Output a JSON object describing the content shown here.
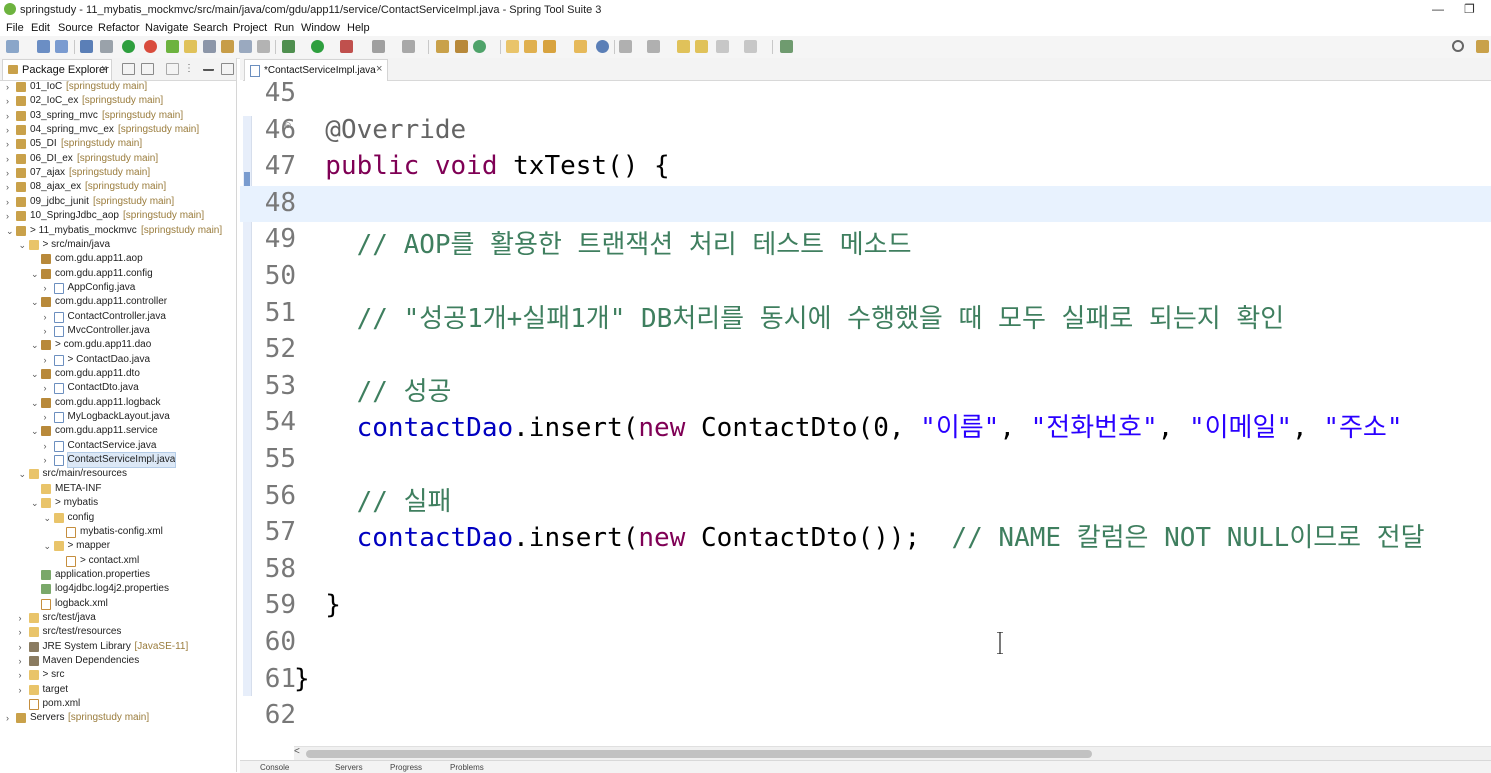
{
  "window": {
    "title": "springstudy - 11_mybatis_mockmvc/src/main/java/com/gdu/app11/service/ContactServiceImpl.java - Spring Tool Suite 3",
    "minimize": "—",
    "maximize": "❐"
  },
  "menu": [
    "File",
    "Edit",
    "Source",
    "Refactor",
    "Navigate",
    "Search",
    "Project",
    "Run",
    "Window",
    "Help"
  ],
  "explorer": {
    "tab_label": "Package Explorer",
    "tree": [
      {
        "label": "01_IoC",
        "deco": "[springstudy main]",
        "indent": 0,
        "arrow": ">",
        "icon": "project"
      },
      {
        "label": "02_IoC_ex",
        "deco": "[springstudy main]",
        "indent": 0,
        "arrow": ">",
        "icon": "project"
      },
      {
        "label": "03_spring_mvc",
        "deco": "[springstudy main]",
        "indent": 0,
        "arrow": ">",
        "icon": "project"
      },
      {
        "label": "04_spring_mvc_ex",
        "deco": "[springstudy main]",
        "indent": 0,
        "arrow": ">",
        "icon": "project"
      },
      {
        "label": "05_DI",
        "deco": "[springstudy main]",
        "indent": 0,
        "arrow": ">",
        "icon": "project"
      },
      {
        "label": "06_DI_ex",
        "deco": "[springstudy main]",
        "indent": 0,
        "arrow": ">",
        "icon": "project"
      },
      {
        "label": "07_ajax",
        "deco": "[springstudy main]",
        "indent": 0,
        "arrow": ">",
        "icon": "project"
      },
      {
        "label": "08_ajax_ex",
        "deco": "[springstudy main]",
        "indent": 0,
        "arrow": ">",
        "icon": "project"
      },
      {
        "label": "09_jdbc_junit",
        "deco": "[springstudy main]",
        "indent": 0,
        "arrow": ">",
        "icon": "project"
      },
      {
        "label": "10_SpringJdbc_aop",
        "deco": "[springstudy main]",
        "indent": 0,
        "arrow": ">",
        "icon": "project"
      },
      {
        "label": "> 11_mybatis_mockmvc",
        "deco": "[springstudy main]",
        "indent": 0,
        "arrow": "v",
        "icon": "project"
      },
      {
        "label": "> src/main/java",
        "deco": "",
        "indent": 1,
        "arrow": "v",
        "icon": "folder"
      },
      {
        "label": "com.gdu.app11.aop",
        "deco": "",
        "indent": 2,
        "arrow": "",
        "icon": "package"
      },
      {
        "label": "com.gdu.app11.config",
        "deco": "",
        "indent": 2,
        "arrow": "v",
        "icon": "package"
      },
      {
        "label": "AppConfig.java",
        "deco": "",
        "indent": 3,
        "arrow": ">",
        "icon": "java"
      },
      {
        "label": "com.gdu.app11.controller",
        "deco": "",
        "indent": 2,
        "arrow": "v",
        "icon": "package"
      },
      {
        "label": "ContactController.java",
        "deco": "",
        "indent": 3,
        "arrow": ">",
        "icon": "java"
      },
      {
        "label": "MvcController.java",
        "deco": "",
        "indent": 3,
        "arrow": ">",
        "icon": "java"
      },
      {
        "label": "> com.gdu.app11.dao",
        "deco": "",
        "indent": 2,
        "arrow": "v",
        "icon": "package"
      },
      {
        "label": "> ContactDao.java",
        "deco": "",
        "indent": 3,
        "arrow": ">",
        "icon": "java"
      },
      {
        "label": "com.gdu.app11.dto",
        "deco": "",
        "indent": 2,
        "arrow": "v",
        "icon": "package"
      },
      {
        "label": "ContactDto.java",
        "deco": "",
        "indent": 3,
        "arrow": ">",
        "icon": "java"
      },
      {
        "label": "com.gdu.app11.logback",
        "deco": "",
        "indent": 2,
        "arrow": "v",
        "icon": "package"
      },
      {
        "label": "MyLogbackLayout.java",
        "deco": "",
        "indent": 3,
        "arrow": ">",
        "icon": "java"
      },
      {
        "label": "com.gdu.app11.service",
        "deco": "",
        "indent": 2,
        "arrow": "v",
        "icon": "package"
      },
      {
        "label": "ContactService.java",
        "deco": "",
        "indent": 3,
        "arrow": ">",
        "icon": "java"
      },
      {
        "label": "ContactServiceImpl.java",
        "deco": "",
        "indent": 3,
        "arrow": ">",
        "icon": "java",
        "selected": true
      },
      {
        "label": "src/main/resources",
        "deco": "",
        "indent": 1,
        "arrow": "v",
        "icon": "folder"
      },
      {
        "label": "META-INF",
        "deco": "",
        "indent": 2,
        "arrow": "",
        "icon": "folder"
      },
      {
        "label": "> mybatis",
        "deco": "",
        "indent": 2,
        "arrow": "v",
        "icon": "folder"
      },
      {
        "label": "config",
        "deco": "",
        "indent": 3,
        "arrow": "v",
        "icon": "folder"
      },
      {
        "label": "mybatis-config.xml",
        "deco": "",
        "indent": 4,
        "arrow": "",
        "icon": "xml"
      },
      {
        "label": "> mapper",
        "deco": "",
        "indent": 3,
        "arrow": "v",
        "icon": "folder"
      },
      {
        "label": "> contact.xml",
        "deco": "",
        "indent": 4,
        "arrow": "",
        "icon": "xml"
      },
      {
        "label": "application.properties",
        "deco": "",
        "indent": 2,
        "arrow": "",
        "icon": "props"
      },
      {
        "label": "log4jdbc.log4j2.properties",
        "deco": "",
        "indent": 2,
        "arrow": "",
        "icon": "props"
      },
      {
        "label": "logback.xml",
        "deco": "",
        "indent": 2,
        "arrow": "",
        "icon": "xml"
      },
      {
        "label": "src/test/java",
        "deco": "",
        "indent": 1,
        "arrow": ">",
        "icon": "folder"
      },
      {
        "label": "src/test/resources",
        "deco": "",
        "indent": 1,
        "arrow": ">",
        "icon": "folder"
      },
      {
        "label": "JRE System Library",
        "deco": "[JavaSE-11]",
        "indent": 1,
        "arrow": ">",
        "icon": "lib"
      },
      {
        "label": "Maven Dependencies",
        "deco": "",
        "indent": 1,
        "arrow": ">",
        "icon": "lib"
      },
      {
        "label": "> src",
        "deco": "",
        "indent": 1,
        "arrow": ">",
        "icon": "folder"
      },
      {
        "label": "target",
        "deco": "",
        "indent": 1,
        "arrow": ">",
        "icon": "folder"
      },
      {
        "label": "pom.xml",
        "deco": "",
        "indent": 1,
        "arrow": "",
        "icon": "xml"
      },
      {
        "label": "Servers",
        "deco": "[springstudy main]",
        "indent": 0,
        "arrow": ">",
        "icon": "project"
      }
    ]
  },
  "editor": {
    "tab_label": "*ContactServiceImpl.java",
    "current_line": "48",
    "lines": [
      {
        "num": "45",
        "tokens": []
      },
      {
        "num": "46",
        "fold": true,
        "tokens": [
          {
            "t": "  @Override",
            "c": "annot"
          }
        ]
      },
      {
        "num": "47",
        "tokens": [
          {
            "t": "  public void ",
            "c": "kw"
          },
          {
            "t": "txTest() {",
            "c": "plain"
          }
        ]
      },
      {
        "num": "48",
        "tokens": [
          {
            "t": "    ",
            "c": "plain"
          }
        ]
      },
      {
        "num": "49",
        "tokens": [
          {
            "t": "    // AOP를 활용한 트랜잭션 처리 테스트 메소드",
            "c": "cmt"
          }
        ]
      },
      {
        "num": "50",
        "tokens": []
      },
      {
        "num": "51",
        "tokens": [
          {
            "t": "    // \"성공1개+실패1개\" DB처리를 동시에 수행했을 때 모두 실패로 되는지 확인",
            "c": "cmt"
          }
        ]
      },
      {
        "num": "52",
        "tokens": []
      },
      {
        "num": "53",
        "tokens": [
          {
            "t": "    // 성공",
            "c": "cmt"
          }
        ]
      },
      {
        "num": "54",
        "tokens": [
          {
            "t": "    contactDao",
            "c": "field"
          },
          {
            "t": ".insert(",
            "c": "plain"
          },
          {
            "t": "new ",
            "c": "kw"
          },
          {
            "t": "ContactDto(0, ",
            "c": "plain"
          },
          {
            "t": "\"이름\"",
            "c": "str"
          },
          {
            "t": ", ",
            "c": "plain"
          },
          {
            "t": "\"전화번호\"",
            "c": "str"
          },
          {
            "t": ", ",
            "c": "plain"
          },
          {
            "t": "\"이메일\"",
            "c": "str"
          },
          {
            "t": ", ",
            "c": "plain"
          },
          {
            "t": "\"주소\"",
            "c": "str"
          }
        ]
      },
      {
        "num": "55",
        "tokens": []
      },
      {
        "num": "56",
        "tokens": [
          {
            "t": "    // 실패",
            "c": "cmt"
          }
        ]
      },
      {
        "num": "57",
        "tokens": [
          {
            "t": "    contactDao",
            "c": "field"
          },
          {
            "t": ".insert(",
            "c": "plain"
          },
          {
            "t": "new ",
            "c": "kw"
          },
          {
            "t": "ContactDto());  ",
            "c": "plain"
          },
          {
            "t": "// NAME 칼럼은 NOT NULL이므로 전달",
            "c": "cmt"
          }
        ]
      },
      {
        "num": "58",
        "tokens": []
      },
      {
        "num": "59",
        "tokens": [
          {
            "t": "  }",
            "c": "plain"
          }
        ]
      },
      {
        "num": "60",
        "tokens": []
      },
      {
        "num": "61",
        "tokens": [
          {
            "t": "}",
            "c": "plain"
          }
        ]
      },
      {
        "num": "62",
        "tokens": []
      }
    ]
  },
  "bottom_tabs": [
    "Console",
    "Servers",
    "Progress",
    "Problems"
  ],
  "colors": {
    "keyword": "#7f0055",
    "string": "#2a00ff",
    "comment": "#3f7f5f",
    "field": "#0000c0",
    "annotation": "#646464",
    "current_line": "#e8f2fe"
  }
}
